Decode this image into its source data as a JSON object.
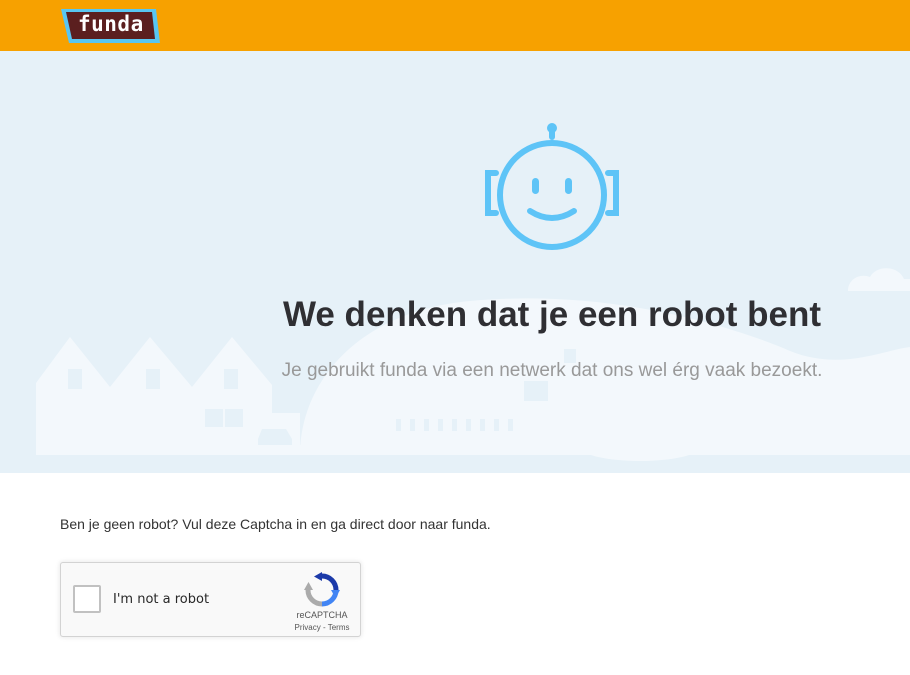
{
  "header": {
    "logo_text": "funda",
    "background_color": "#f7a100",
    "logo_color": "#5b1f1f"
  },
  "hero": {
    "icon": "robot-face-icon",
    "title": "We denken dat je een robot bent",
    "subtitle": "Je gebruikt funda via een netwerk dat ons wel érg vaak bezoekt.",
    "background_color": "#e6f1f8",
    "accent_color": "#5ec4f7"
  },
  "main": {
    "intro_text": "Ben je geen robot? Vul deze Captcha in en ga direct door naar funda."
  },
  "recaptcha": {
    "checkbox_label": "I'm not a robot",
    "brand": "reCAPTCHA",
    "privacy_label": "Privacy",
    "separator": " - ",
    "terms_label": "Terms",
    "checked": false
  }
}
